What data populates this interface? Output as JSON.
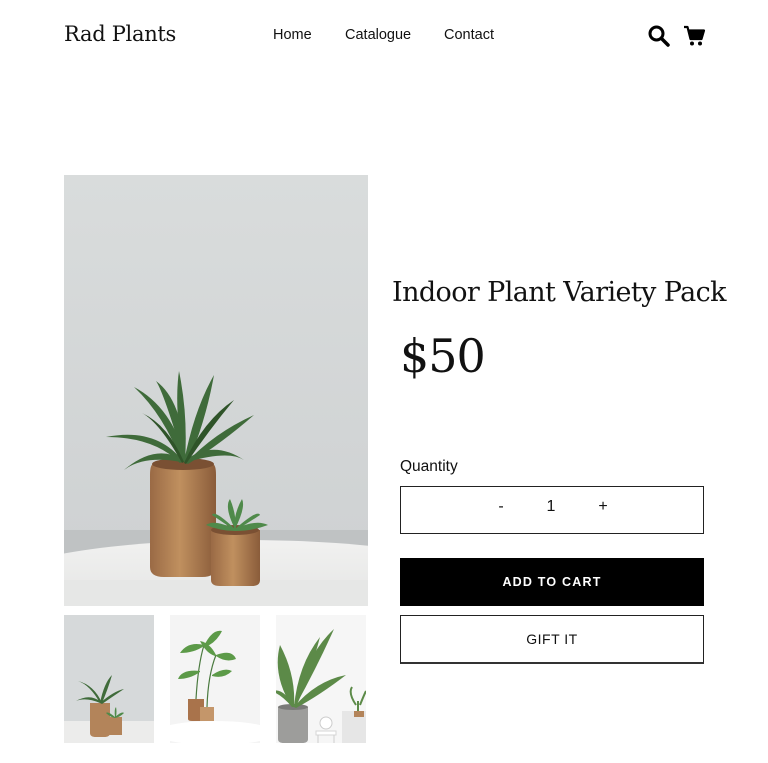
{
  "header": {
    "brand": "Rad Plants",
    "nav": [
      "Home",
      "Catalogue",
      "Contact"
    ],
    "icons": [
      "search-icon",
      "shopping-cart-icon"
    ]
  },
  "product": {
    "title": "Indoor Plant Variety Pack",
    "price": "$50",
    "quantity_label": "Quantity",
    "quantity_minus": "-",
    "quantity_value": "1",
    "quantity_plus": "+",
    "add_to_cart_label": "ADD TO CART",
    "gift_label": "GIFT IT"
  },
  "colors": {
    "primary": "#000000",
    "background": "#ffffff"
  }
}
